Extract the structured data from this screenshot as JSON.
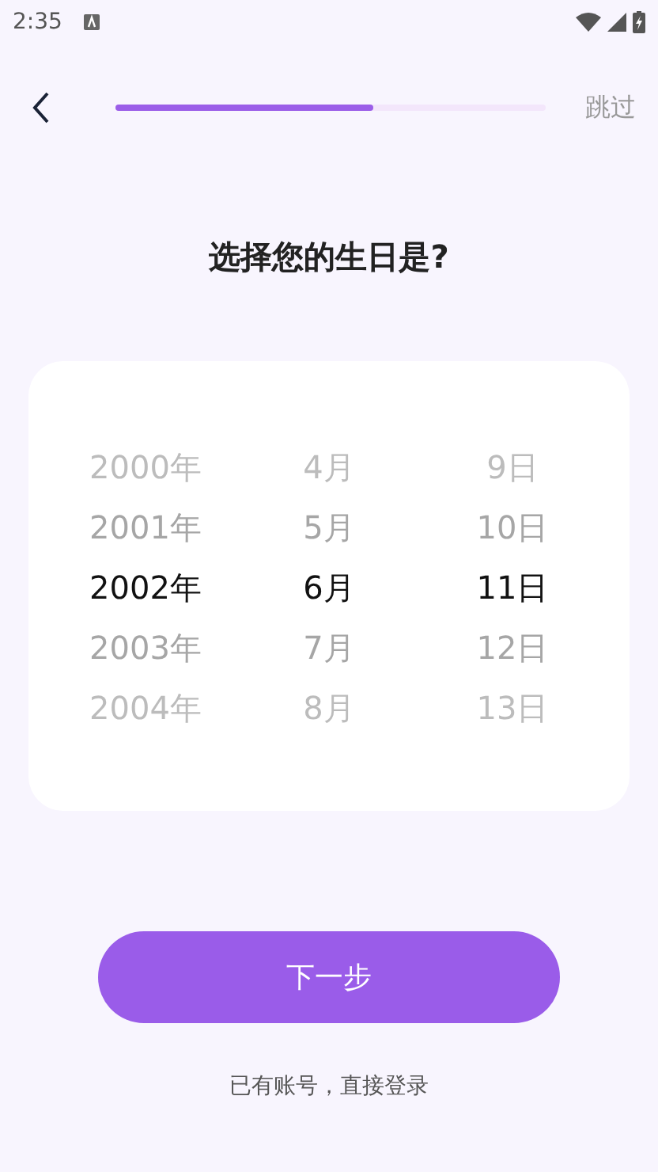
{
  "status_bar": {
    "time": "2:35"
  },
  "header": {
    "progress": {
      "level": 0.6
    },
    "skip": "跳过"
  },
  "title": "选择您的生日是?",
  "picker": {
    "columns": [
      {
        "items": [
          {
            "label": "2000年",
            "selected": false
          },
          {
            "label": "2001年",
            "selected": false
          },
          {
            "label": "2002年",
            "selected": true
          },
          {
            "label": "2003年",
            "selected": false
          },
          {
            "label": "2004年",
            "selected": false
          }
        ]
      },
      {
        "items": [
          {
            "label": "4月",
            "selected": false
          },
          {
            "label": "5月",
            "selected": false
          },
          {
            "label": "6月",
            "selected": true
          },
          {
            "label": "7月",
            "selected": false
          },
          {
            "label": "8月",
            "selected": false
          }
        ]
      },
      {
        "items": [
          {
            "label": "9日",
            "selected": false
          },
          {
            "label": "10日",
            "selected": false
          },
          {
            "label": "11日",
            "selected": true
          },
          {
            "label": "12日",
            "selected": false
          },
          {
            "label": "13日",
            "selected": false
          }
        ]
      }
    ]
  },
  "next_button": "下一步",
  "login_link": "已有账号，直接登录"
}
